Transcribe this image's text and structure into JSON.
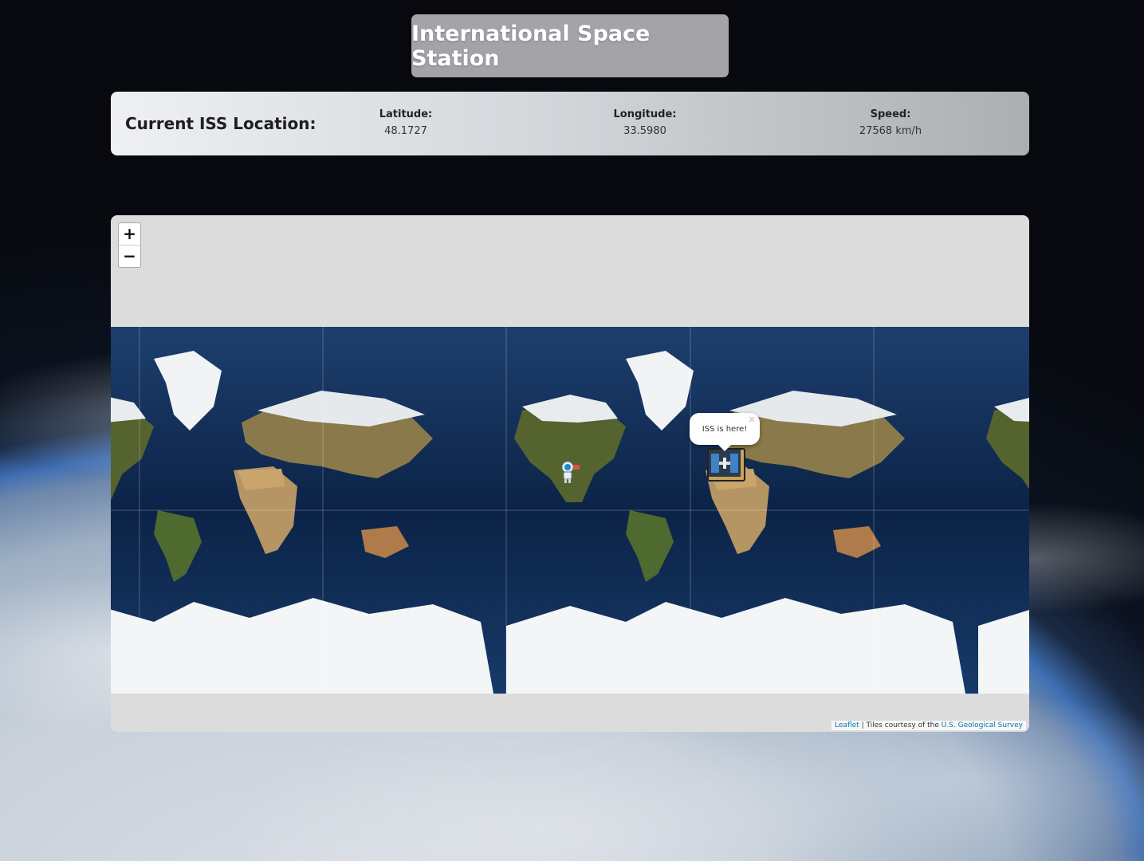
{
  "header": {
    "title": "International Space Station"
  },
  "location": {
    "heading": "Current ISS Location:",
    "latitude_label": "Latitude:",
    "latitude_value": "48.1727",
    "longitude_label": "Longitude:",
    "longitude_value": "33.5980",
    "speed_label": "Speed:",
    "speed_value": "27568 km/h"
  },
  "map": {
    "zoom_in": "+",
    "zoom_out": "−",
    "popup_text": "ISS is here!",
    "popup_close": "×",
    "attribution_leaflet": "Leaflet",
    "attribution_text": " | Tiles courtesy of the ",
    "attribution_link": "U.S. Geological Survey",
    "markers": {
      "iss_icon": "space-station-icon",
      "astronaut_icon": "astronaut-icon"
    }
  }
}
